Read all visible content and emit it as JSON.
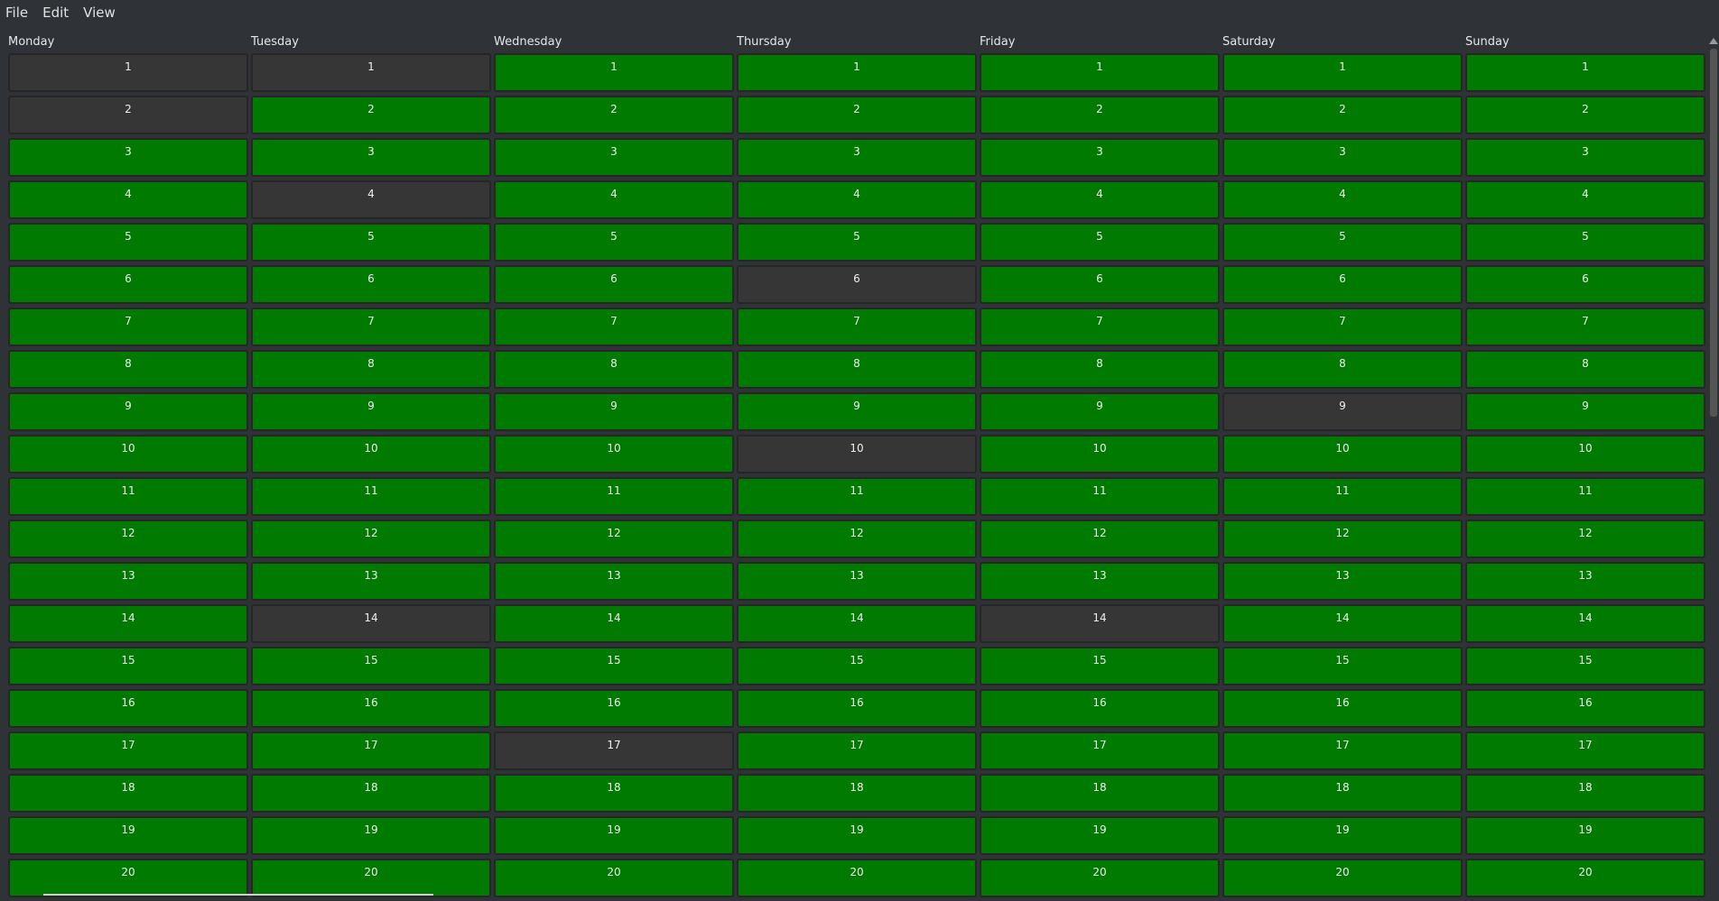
{
  "menu": [
    "File",
    "Edit",
    "View"
  ],
  "colors": {
    "available": "#007a00",
    "unavailable": "#363636",
    "background": "#2f3338"
  },
  "slots": [
    1,
    2,
    3,
    4,
    5,
    6,
    7,
    8,
    9,
    10,
    11,
    12,
    13,
    14,
    15,
    16,
    17,
    18,
    19,
    20
  ],
  "days": [
    {
      "name": "Monday",
      "unavailable": [
        1,
        2
      ]
    },
    {
      "name": "Tuesday",
      "unavailable": [
        1,
        4,
        14
      ]
    },
    {
      "name": "Wednesday",
      "unavailable": [
        17
      ]
    },
    {
      "name": "Thursday",
      "unavailable": [
        6,
        10
      ]
    },
    {
      "name": "Friday",
      "unavailable": [
        14
      ]
    },
    {
      "name": "Saturday",
      "unavailable": [
        9
      ]
    },
    {
      "name": "Sunday",
      "unavailable": []
    }
  ]
}
